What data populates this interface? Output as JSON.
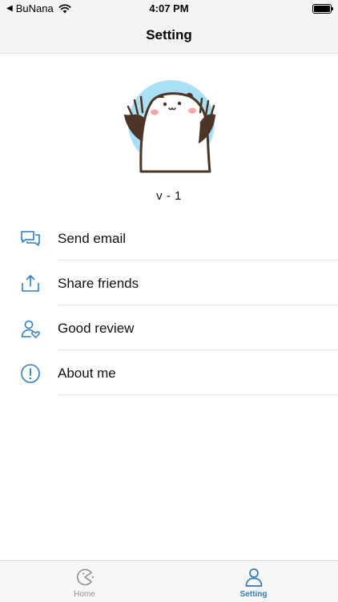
{
  "status_bar": {
    "back_arrow": "◀",
    "carrier": "BuNana",
    "time": "4:07 PM",
    "wifi_icon": "wifi-icon",
    "battery_icon": "battery-icon"
  },
  "nav": {
    "title": "Setting"
  },
  "profile": {
    "avatar_icon": "bear-waving-illustration",
    "version": "v - 1"
  },
  "menu": {
    "items": [
      {
        "label": "Send email",
        "icon": "chat-bubbles-icon"
      },
      {
        "label": "Share friends",
        "icon": "share-icon"
      },
      {
        "label": "Good review",
        "icon": "user-heart-icon"
      },
      {
        "label": "About me",
        "icon": "info-icon"
      }
    ]
  },
  "tab_bar": {
    "tabs": [
      {
        "label": "Home",
        "icon": "pacman-icon",
        "selected": false
      },
      {
        "label": "Setting",
        "icon": "person-icon",
        "selected": true
      }
    ]
  },
  "colors": {
    "accent": "#2f7bbd",
    "avatar_circle": "#a9e0f5",
    "bear_outline": "#4a3526",
    "inactive_tab": "#8e8e93"
  }
}
